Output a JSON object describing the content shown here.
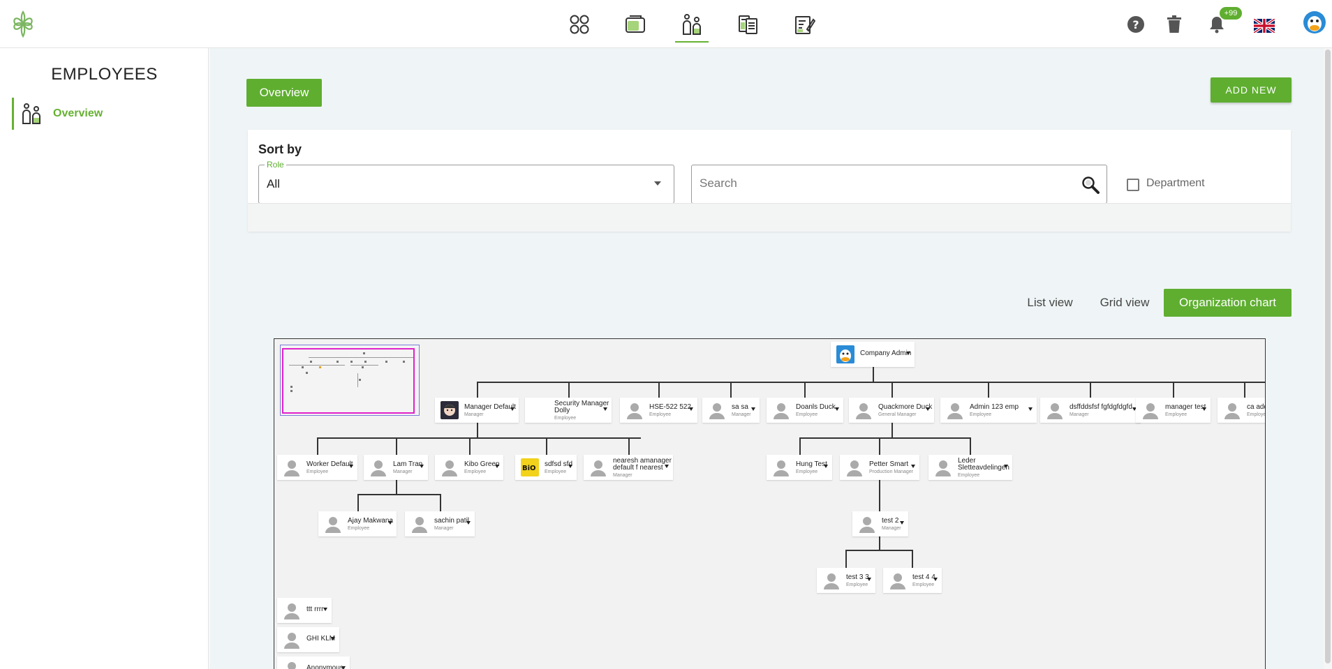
{
  "topbar": {
    "notifications_count": "+99",
    "nav_icons": [
      "dashboard-icon",
      "inbox-icon",
      "employees-icon",
      "documents-icon",
      "forms-icon"
    ],
    "right_icons": [
      "help-icon",
      "trash-icon",
      "bell-icon",
      "uk-flag-icon",
      "user-avatar"
    ]
  },
  "sidebar": {
    "title": "EMPLOYEES",
    "items": [
      {
        "label": "Overview",
        "icon": "employees-icon",
        "active": true
      }
    ]
  },
  "main": {
    "overview_label": "Overview",
    "add_new_label": "ADD NEW",
    "sort": {
      "title": "Sort by",
      "role_legend": "Role",
      "role_value": "All",
      "search_placeholder": "Search",
      "department_label": "Department",
      "department_checked": false
    },
    "views": {
      "list": "List view",
      "grid": "Grid view",
      "org": "Organization chart",
      "active": "org"
    }
  },
  "org_chart": {
    "root": {
      "name": "Company Admin",
      "role": ""
    },
    "nodes": [
      {
        "name": "Manager Default",
        "role": "Manager"
      },
      {
        "name": "Security Manager Dolly",
        "role": "Employee"
      },
      {
        "name": "HSE-522 522",
        "role": "Employee"
      },
      {
        "name": "sa sa",
        "role": "Manager"
      },
      {
        "name": "Doanls Duck",
        "role": "Employee"
      },
      {
        "name": "Quackmore Duck",
        "role": "General Manager"
      },
      {
        "name": "Admin 123 emp",
        "role": "Employee"
      },
      {
        "name": "dsffddsfsf fgfdgfdgfd",
        "role": "Manager"
      },
      {
        "name": "manager test",
        "role": "Employee"
      },
      {
        "name": "ca adde",
        "role": "Employee"
      },
      {
        "name": "Worker Default",
        "role": "Employee"
      },
      {
        "name": "Lam Tran",
        "role": "Manager"
      },
      {
        "name": "Kibo Green",
        "role": "Employee"
      },
      {
        "name": "sdfsd sfd",
        "role": "Employee"
      },
      {
        "name": "nearesh amanager default f nearest",
        "role": "Manager"
      },
      {
        "name": "Hung Test",
        "role": "Employee"
      },
      {
        "name": "Petter Smart",
        "role": "Production Manager"
      },
      {
        "name": "Leder Sletteavdelingen",
        "role": "Employee"
      },
      {
        "name": "Ajay Makwana",
        "role": "Employee"
      },
      {
        "name": "sachin patil",
        "role": "Manager"
      },
      {
        "name": "test 2",
        "role": "Manager"
      },
      {
        "name": "test 3 3",
        "role": "Employee"
      },
      {
        "name": "test 4 4",
        "role": "Employee"
      },
      {
        "name": "ttt rrrr",
        "role": ""
      },
      {
        "name": "GHI KLM",
        "role": ""
      },
      {
        "name": "Anonymous",
        "role": ""
      }
    ]
  },
  "colors": {
    "accent": "#5fae30",
    "main_bg": "#eff5f6",
    "minimap_viewport": "#e020c8"
  }
}
